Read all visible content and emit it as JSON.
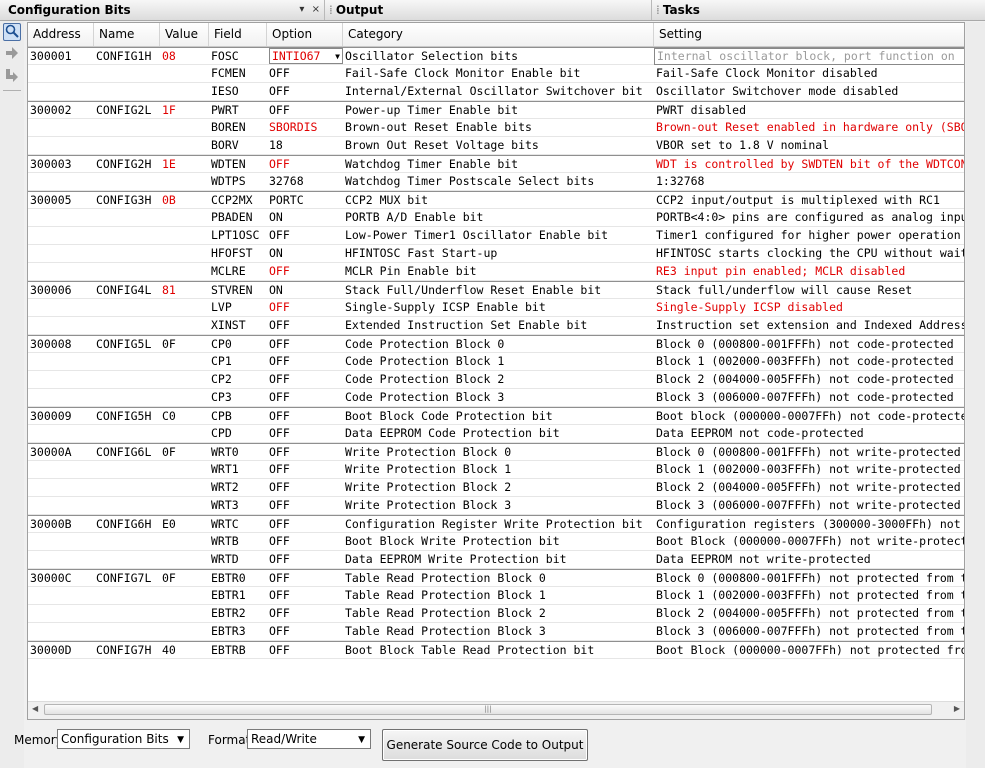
{
  "tabs": {
    "config": "Configuration Bits",
    "output": "Output",
    "tasks": "Tasks",
    "pin_icon": "▾",
    "close_icon": "×"
  },
  "columns": [
    "Address",
    "Name",
    "Value",
    "Field",
    "Option",
    "Category",
    "Setting"
  ],
  "rows": [
    {
      "addr": "300001",
      "name": "CONFIG1H",
      "value": "08",
      "vred": true,
      "field": "FOSC",
      "option": "INTIO67",
      "ored": true,
      "category": "Oscillator Selection bits",
      "setting": "Internal oscillator block, port function on",
      "sred": false,
      "editing": true
    },
    {
      "addr": "",
      "name": "",
      "value": "",
      "vred": false,
      "field": "FCMEN",
      "option": "OFF",
      "ored": false,
      "category": "Fail-Safe Clock Monitor Enable bit",
      "setting": "Fail-Safe Clock Monitor disabled",
      "sred": false
    },
    {
      "addr": "",
      "name": "",
      "value": "",
      "vred": false,
      "field": "IESO",
      "option": "OFF",
      "ored": false,
      "category": "Internal/External Oscillator Switchover bit",
      "setting": "Oscillator Switchover mode disabled",
      "sred": false
    },
    {
      "addr": "300002",
      "name": "CONFIG2L",
      "value": "1F",
      "vred": true,
      "field": "PWRT",
      "option": "OFF",
      "ored": false,
      "category": "Power-up Timer Enable bit",
      "setting": "PWRT disabled",
      "sred": false
    },
    {
      "addr": "",
      "name": "",
      "value": "",
      "vred": false,
      "field": "BOREN",
      "option": "SBORDIS",
      "ored": true,
      "category": "Brown-out Reset Enable bits",
      "setting": "Brown-out Reset enabled in hardware only (SBO",
      "sred": true
    },
    {
      "addr": "",
      "name": "",
      "value": "",
      "vred": false,
      "field": "BORV",
      "option": "18",
      "ored": false,
      "category": "Brown Out Reset Voltage bits",
      "setting": "VBOR set to 1.8 V nominal",
      "sred": false
    },
    {
      "addr": "300003",
      "name": "CONFIG2H",
      "value": "1E",
      "vred": true,
      "field": "WDTEN",
      "option": "OFF",
      "ored": true,
      "category": "Watchdog Timer Enable bit",
      "setting": "WDT is controlled by SWDTEN bit of the WDTCON",
      "sred": true
    },
    {
      "addr": "",
      "name": "",
      "value": "",
      "vred": false,
      "field": "WDTPS",
      "option": "32768",
      "ored": false,
      "category": "Watchdog Timer Postscale Select bits",
      "setting": "1:32768",
      "sred": false
    },
    {
      "addr": "300005",
      "name": "CONFIG3H",
      "value": "0B",
      "vred": true,
      "field": "CCP2MX",
      "option": "PORTC",
      "ored": false,
      "category": "CCP2 MUX bit",
      "setting": "CCP2 input/output is multiplexed with RC1",
      "sred": false
    },
    {
      "addr": "",
      "name": "",
      "value": "",
      "vred": false,
      "field": "PBADEN",
      "option": "ON",
      "ored": false,
      "category": "PORTB A/D Enable bit",
      "setting": "PORTB<4:0> pins are configured as analog inpu",
      "sred": false
    },
    {
      "addr": "",
      "name": "",
      "value": "",
      "vred": false,
      "field": "LPT1OSC",
      "option": "OFF",
      "ored": false,
      "category": "Low-Power Timer1 Oscillator Enable bit",
      "setting": "Timer1 configured for higher power operation",
      "sred": false
    },
    {
      "addr": "",
      "name": "",
      "value": "",
      "vred": false,
      "field": "HFOFST",
      "option": "ON",
      "ored": false,
      "category": "HFINTOSC Fast Start-up",
      "setting": "HFINTOSC starts clocking the CPU without wait",
      "sred": false
    },
    {
      "addr": "",
      "name": "",
      "value": "",
      "vred": false,
      "field": "MCLRE",
      "option": "OFF",
      "ored": true,
      "category": "MCLR Pin Enable bit",
      "setting": "RE3 input pin enabled; MCLR disabled",
      "sred": true
    },
    {
      "addr": "300006",
      "name": "CONFIG4L",
      "value": "81",
      "vred": true,
      "field": "STVREN",
      "option": "ON",
      "ored": false,
      "category": "Stack Full/Underflow Reset Enable bit",
      "setting": "Stack full/underflow will cause Reset",
      "sred": false
    },
    {
      "addr": "",
      "name": "",
      "value": "",
      "vred": false,
      "field": "LVP",
      "option": "OFF",
      "ored": true,
      "category": "Single-Supply ICSP Enable bit",
      "setting": "Single-Supply ICSP disabled",
      "sred": true
    },
    {
      "addr": "",
      "name": "",
      "value": "",
      "vred": false,
      "field": "XINST",
      "option": "OFF",
      "ored": false,
      "category": "Extended Instruction Set Enable bit",
      "setting": "Instruction set extension and Indexed Address",
      "sred": false
    },
    {
      "addr": "300008",
      "name": "CONFIG5L",
      "value": "0F",
      "vred": false,
      "field": "CP0",
      "option": "OFF",
      "ored": false,
      "category": "Code Protection Block 0",
      "setting": "Block 0 (000800-001FFFh) not code-protected",
      "sred": false
    },
    {
      "addr": "",
      "name": "",
      "value": "",
      "vred": false,
      "field": "CP1",
      "option": "OFF",
      "ored": false,
      "category": "Code Protection Block 1",
      "setting": "Block 1 (002000-003FFFh) not code-protected",
      "sred": false
    },
    {
      "addr": "",
      "name": "",
      "value": "",
      "vred": false,
      "field": "CP2",
      "option": "OFF",
      "ored": false,
      "category": "Code Protection Block 2",
      "setting": "Block 2 (004000-005FFFh) not code-protected",
      "sred": false
    },
    {
      "addr": "",
      "name": "",
      "value": "",
      "vred": false,
      "field": "CP3",
      "option": "OFF",
      "ored": false,
      "category": "Code Protection Block 3",
      "setting": "Block 3 (006000-007FFFh) not code-protected",
      "sred": false
    },
    {
      "addr": "300009",
      "name": "CONFIG5H",
      "value": "C0",
      "vred": false,
      "field": "CPB",
      "option": "OFF",
      "ored": false,
      "category": "Boot Block Code Protection bit",
      "setting": "Boot block (000000-0007FFh) not code-protecte",
      "sred": false
    },
    {
      "addr": "",
      "name": "",
      "value": "",
      "vred": false,
      "field": "CPD",
      "option": "OFF",
      "ored": false,
      "category": "Data EEPROM Code Protection bit",
      "setting": "Data EEPROM not code-protected",
      "sred": false
    },
    {
      "addr": "30000A",
      "name": "CONFIG6L",
      "value": "0F",
      "vred": false,
      "field": "WRT0",
      "option": "OFF",
      "ored": false,
      "category": "Write Protection Block 0",
      "setting": "Block 0 (000800-001FFFh) not write-protected",
      "sred": false
    },
    {
      "addr": "",
      "name": "",
      "value": "",
      "vred": false,
      "field": "WRT1",
      "option": "OFF",
      "ored": false,
      "category": "Write Protection Block 1",
      "setting": "Block 1 (002000-003FFFh) not write-protected",
      "sred": false
    },
    {
      "addr": "",
      "name": "",
      "value": "",
      "vred": false,
      "field": "WRT2",
      "option": "OFF",
      "ored": false,
      "category": "Write Protection Block 2",
      "setting": "Block 2 (004000-005FFFh) not write-protected",
      "sred": false
    },
    {
      "addr": "",
      "name": "",
      "value": "",
      "vred": false,
      "field": "WRT3",
      "option": "OFF",
      "ored": false,
      "category": "Write Protection Block 3",
      "setting": "Block 3 (006000-007FFFh) not write-protected",
      "sred": false
    },
    {
      "addr": "30000B",
      "name": "CONFIG6H",
      "value": "E0",
      "vred": false,
      "field": "WRTC",
      "option": "OFF",
      "ored": false,
      "category": "Configuration Register Write Protection bit",
      "setting": "Configuration registers (300000-3000FFh) not",
      "sred": false
    },
    {
      "addr": "",
      "name": "",
      "value": "",
      "vred": false,
      "field": "WRTB",
      "option": "OFF",
      "ored": false,
      "category": "Boot Block Write Protection bit",
      "setting": "Boot Block (000000-0007FFh) not write-protect",
      "sred": false
    },
    {
      "addr": "",
      "name": "",
      "value": "",
      "vred": false,
      "field": "WRTD",
      "option": "OFF",
      "ored": false,
      "category": "Data EEPROM Write Protection bit",
      "setting": "Data EEPROM not write-protected",
      "sred": false
    },
    {
      "addr": "30000C",
      "name": "CONFIG7L",
      "value": "0F",
      "vred": false,
      "field": "EBTR0",
      "option": "OFF",
      "ored": false,
      "category": "Table Read Protection Block 0",
      "setting": "Block 0 (000800-001FFFh) not protected from t",
      "sred": false
    },
    {
      "addr": "",
      "name": "",
      "value": "",
      "vred": false,
      "field": "EBTR1",
      "option": "OFF",
      "ored": false,
      "category": "Table Read Protection Block 1",
      "setting": "Block 1 (002000-003FFFh) not protected from t",
      "sred": false
    },
    {
      "addr": "",
      "name": "",
      "value": "",
      "vred": false,
      "field": "EBTR2",
      "option": "OFF",
      "ored": false,
      "category": "Table Read Protection Block 2",
      "setting": "Block 2 (004000-005FFFh) not protected from t",
      "sred": false
    },
    {
      "addr": "",
      "name": "",
      "value": "",
      "vred": false,
      "field": "EBTR3",
      "option": "OFF",
      "ored": false,
      "category": "Table Read Protection Block 3",
      "setting": "Block 3 (006000-007FFFh) not protected from t",
      "sred": false
    },
    {
      "addr": "30000D",
      "name": "CONFIG7H",
      "value": "40",
      "vred": false,
      "field": "EBTRB",
      "option": "OFF",
      "ored": false,
      "category": "Boot Block Table Read Protection bit",
      "setting": "Boot Block (000000-0007FFh) not protected fro",
      "sred": false
    }
  ],
  "bottom": {
    "memory_label": "Memory",
    "memory_value": "Configuration Bits",
    "format_label": "Format",
    "format_value": "Read/Write",
    "generate_button": "Generate Source Code to Output"
  },
  "colors": {
    "changed_value": "#e00000",
    "accent": "#1d4f91"
  },
  "icons": [
    "search-icon",
    "arrow-right-icon",
    "arrow-down-right-icon",
    "pin-icon",
    "close-icon",
    "dropdown-arrow-icon"
  ]
}
